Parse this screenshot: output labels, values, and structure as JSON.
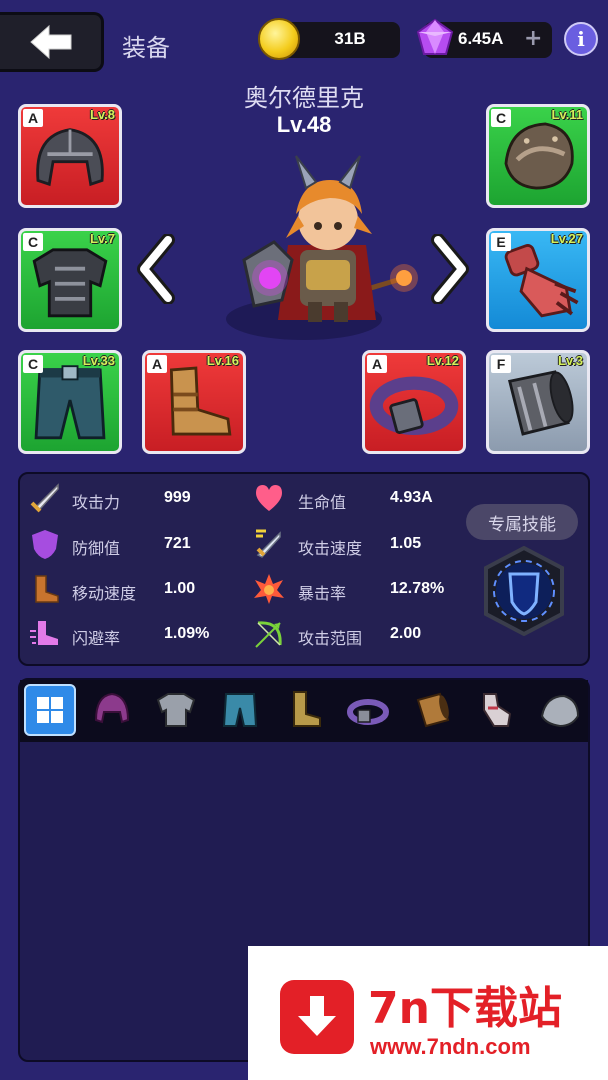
{
  "header": {
    "title": "装备",
    "coins": "31B",
    "gems": "6.45A",
    "gem_plus": "+",
    "info": "i"
  },
  "hero": {
    "name": "奥尔德里克",
    "level": "Lv.48"
  },
  "slots": [
    {
      "name": "helmet",
      "grade": "A",
      "level": "Lv.8"
    },
    {
      "name": "shoulder",
      "grade": "C",
      "level": "Lv.11"
    },
    {
      "name": "armor",
      "grade": "C",
      "level": "Lv.7"
    },
    {
      "name": "gloves",
      "grade": "E",
      "level": "Lv.27"
    },
    {
      "name": "pants",
      "grade": "C",
      "level": "Lv.33"
    },
    {
      "name": "boots",
      "grade": "A",
      "level": "Lv.16"
    },
    {
      "name": "belt",
      "grade": "A",
      "level": "Lv.12"
    },
    {
      "name": "bracer",
      "grade": "F",
      "level": "Lv.3"
    }
  ],
  "stats": [
    {
      "label": "攻击力",
      "value": "999",
      "icon": "sword-icon"
    },
    {
      "label": "生命值",
      "value": "4.93A",
      "icon": "heart-icon"
    },
    {
      "label": "防御值",
      "value": "721",
      "icon": "shield-icon"
    },
    {
      "label": "攻击速度",
      "value": "1.05",
      "icon": "attack-speed-icon"
    },
    {
      "label": "移动速度",
      "value": "1.00",
      "icon": "boot-icon"
    },
    {
      "label": "暴击率",
      "value": "12.78%",
      "icon": "crit-icon"
    },
    {
      "label": "闪避率",
      "value": "1.09%",
      "icon": "dodge-icon"
    },
    {
      "label": "攻击范围",
      "value": "2.00",
      "icon": "bow-icon"
    }
  ],
  "skill": {
    "label": "专属技能"
  },
  "inventory_tabs": [
    "all-grid-icon",
    "helmet-icon",
    "armor-icon",
    "pants-icon",
    "boots-icon",
    "belt-icon",
    "bracer-icon",
    "gloves-icon",
    "shoulder-icon"
  ],
  "watermark": {
    "title": "7n下载站",
    "url": "www.7ndn.com"
  }
}
